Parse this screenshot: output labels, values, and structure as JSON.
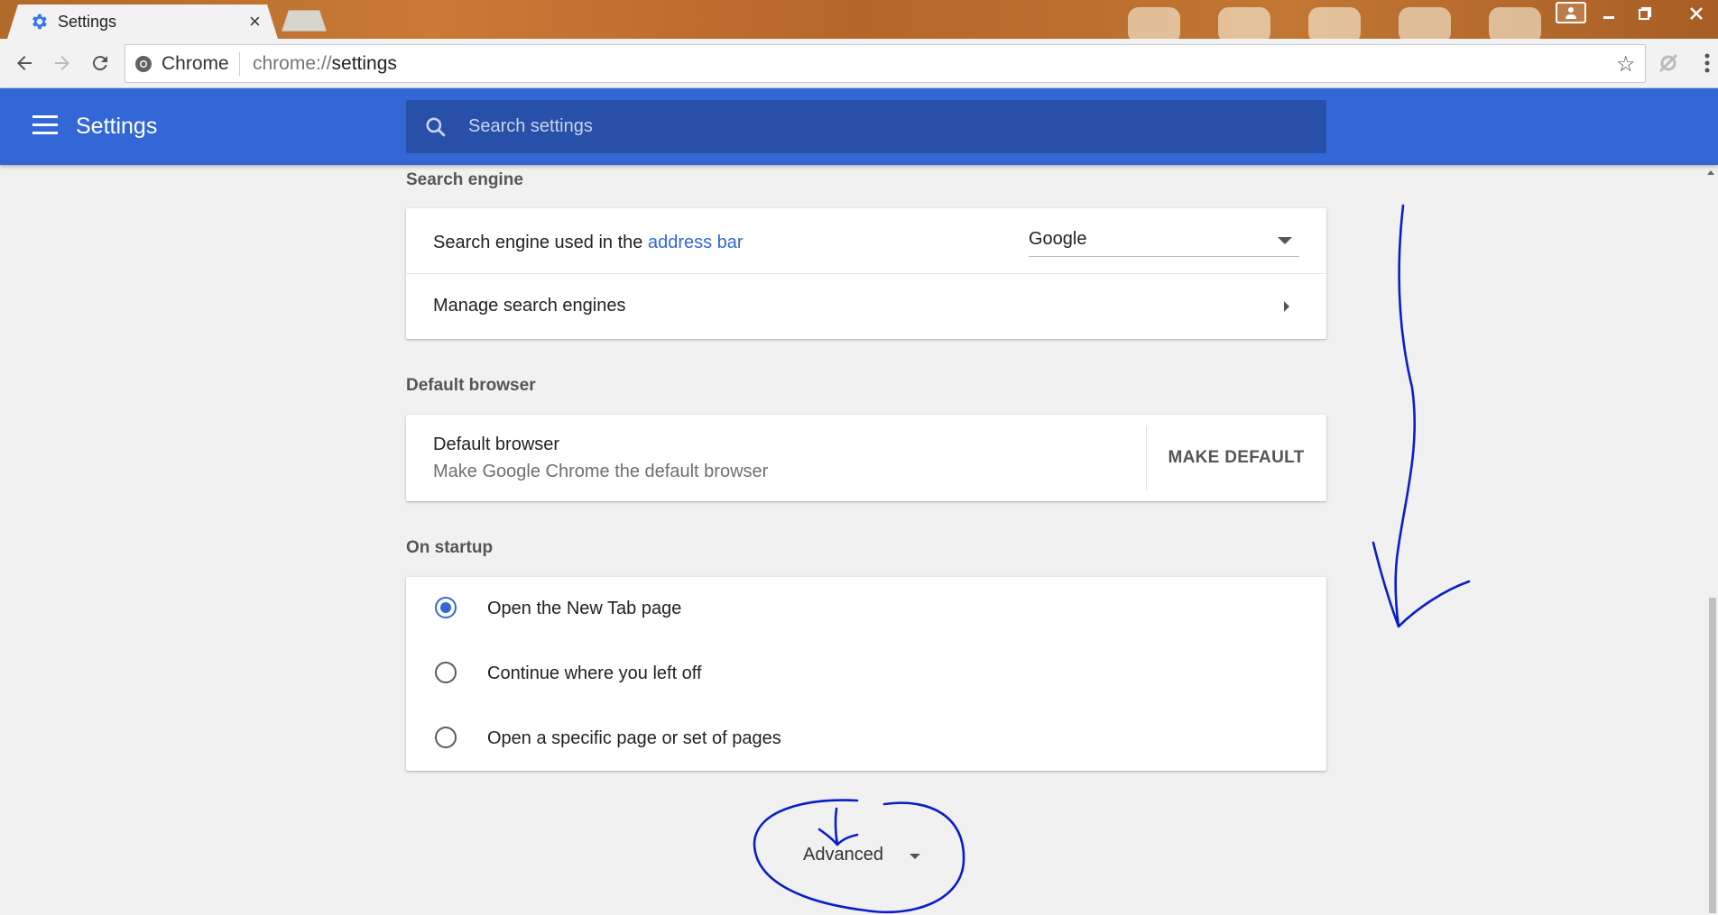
{
  "browser": {
    "tab_title": "Settings",
    "tab_close": "×",
    "omnibox_chip": "Chrome",
    "url_scheme": "chrome://",
    "url_path": "settings"
  },
  "header": {
    "title": "Settings",
    "search_placeholder": "Search settings"
  },
  "search_engine": {
    "section_title": "Search engine",
    "row1_prefix": "Search engine used in the ",
    "row1_link": "address bar",
    "selected_engine": "Google",
    "row2_label": "Manage search engines"
  },
  "default_browser": {
    "section_title": "Default browser",
    "title": "Default browser",
    "subtitle": "Make Google Chrome the default browser",
    "button": "MAKE DEFAULT"
  },
  "on_startup": {
    "section_title": "On startup",
    "options": [
      {
        "label": "Open the New Tab page",
        "checked": true
      },
      {
        "label": "Continue where you left off",
        "checked": false
      },
      {
        "label": "Open a specific page or set of pages",
        "checked": false
      }
    ]
  },
  "advanced": {
    "label": "Advanced"
  },
  "colors": {
    "header_blue": "#3367d6",
    "search_box": "#2850a8",
    "link_blue": "#3367d6",
    "annotation_ink": "#0a1ec8"
  }
}
